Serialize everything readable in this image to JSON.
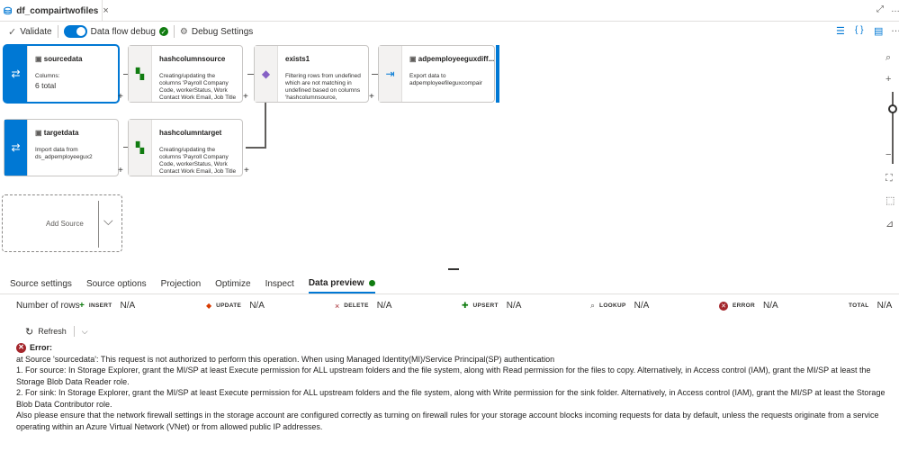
{
  "tab": {
    "title": "df_compairtwofiles",
    "close": "×"
  },
  "toolbar": {
    "validate": "Validate",
    "dataflow_debug": "Data flow debug",
    "debug_settings": "Debug Settings"
  },
  "nodes": {
    "sourcedata": {
      "title": "sourcedata",
      "label": "Columns:",
      "value": "6 total"
    },
    "hashcolumnsource": {
      "title": "hashcolumnsource",
      "desc": "Creating/updating the columns 'Payroll Company Code, workerStatus, Work Contact Work Email, Job Title"
    },
    "exists1": {
      "title": "exists1",
      "desc": "Filtering rows from undefined which are not matching in undefined based on columns 'hashcolumnsource,"
    },
    "sink": {
      "title": "adpemployeeguxdiff...",
      "desc": "Export data to adpemployeefileguxcompair"
    },
    "targetdata": {
      "title": "targetdata",
      "desc": "Import data from ds_adpemployeegux2"
    },
    "hashcolumntarget": {
      "title": "hashcolumntarget",
      "desc": "Creating/updating the columns 'Payroll Company Code, workerStatus, Work Contact Work Email, Job Title"
    },
    "add_source": "Add Source"
  },
  "bottom_tabs": [
    "Source settings",
    "Source options",
    "Projection",
    "Optimize",
    "Inspect",
    "Data preview"
  ],
  "stats": {
    "label": "Number of rows",
    "insert": "INSERT",
    "insert_val": "N/A",
    "update": "UPDATE",
    "update_val": "N/A",
    "delete": "DELETE",
    "delete_val": "N/A",
    "upsert": "UPSERT",
    "upsert_val": "N/A",
    "lookup": "LOOKUP",
    "lookup_val": "N/A",
    "error": "ERROR",
    "error_val": "N/A",
    "total": "TOTAL",
    "total_val": "N/A"
  },
  "refresh": "Refresh",
  "error": {
    "title": "Error:",
    "line1": "at Source 'sourcedata': This request is not authorized to perform this operation. When using Managed Identity(MI)/Service Principal(SP) authentication",
    "line2": "1. For source: In Storage Explorer, grant the MI/SP at least Execute permission for ALL upstream folders and the file system, along with Read permission for the files to copy. Alternatively, in Access control (IAM), grant the MI/SP at least the Storage Blob Data Reader role.",
    "line3": "2. For sink: In Storage Explorer, grant the MI/SP at least Execute permission for ALL upstream folders and the file system, along with Write permission for the sink folder. Alternatively, in Access control (IAM), grant the MI/SP at least the Storage Blob Data Contributor role.",
    "line4": "Also please ensure that the network firewall settings in the storage account are configured correctly as turning on firewall rules for your storage account blocks incoming requests for data by default, unless the requests originate from a service operating within an Azure Virtual Network (VNet) or from allowed public IP addresses."
  }
}
